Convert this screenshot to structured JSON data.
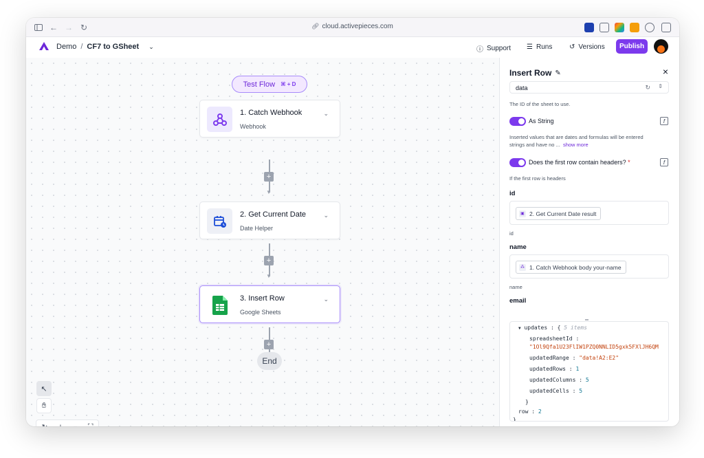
{
  "browser": {
    "url": "cloud.activepieces.com"
  },
  "header": {
    "project": "Demo",
    "separator": "/",
    "flow_name": "CF7 to GSheet",
    "support_label": "Support",
    "runs_label": "Runs",
    "versions_label": "Versions",
    "publish_label": "Publish"
  },
  "canvas": {
    "test_flow_label": "Test Flow",
    "test_flow_shortcut": "⌘ + D",
    "steps": [
      {
        "title": "1. Catch Webhook",
        "subtitle": "Webhook"
      },
      {
        "title": "2. Get Current Date",
        "subtitle": "Date Helper"
      },
      {
        "title": "3. Insert Row",
        "subtitle": "Google Sheets"
      }
    ],
    "end_label": "End"
  },
  "panel": {
    "title": "Insert Row",
    "sheet_value": "data",
    "sheet_help": "The ID of the sheet to use.",
    "as_string_label": "As String",
    "as_string_help_1": "Inserted values that are dates and formulas will be entered",
    "as_string_help_2": "strings and have no ...",
    "show_more": "show more",
    "headers_label": "Does the first row contain headers?",
    "headers_required": "*",
    "headers_help": "If the first row is headers",
    "id_label": "id",
    "id_chip": "2. Get Current Date result",
    "id_help": "id",
    "name_label": "name",
    "name_chip": "1. Catch Webhook body your-name",
    "name_help": "name",
    "email_label": "email",
    "json": {
      "updates_key": "updates",
      "updates_count": "5 items",
      "spreadsheetId_key": "spreadsheetId",
      "spreadsheetId_val": "\"1Ol9Qfa1U23FlIW1PZQ0NNLID5gxk5FXlJH6QM",
      "updatedRange_key": "updatedRange",
      "updatedRange_val": "\"data!A2:E2\"",
      "updatedRows_key": "updatedRows",
      "updatedRows_val": "1",
      "updatedColumns_key": "updatedColumns",
      "updatedColumns_val": "5",
      "updatedCells_key": "updatedCells",
      "updatedCells_val": "5",
      "row_key": "row",
      "row_val": "2"
    }
  },
  "colors": {
    "accent": "#7c3aed",
    "accent_light": "#f3e8ff"
  }
}
